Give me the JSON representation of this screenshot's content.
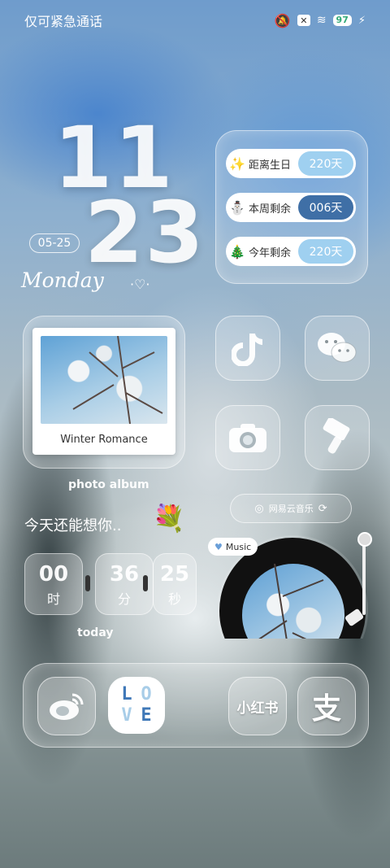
{
  "status_bar": {
    "carrier_text": "仅可紧急通话",
    "battery": "97"
  },
  "clock": {
    "hour": "11",
    "minute": "23",
    "date": "05-25",
    "weekday": "Monday"
  },
  "countdown": {
    "items": [
      {
        "emoji": "✨",
        "label": "距离生日",
        "value": "220天",
        "color": "#9fd0f0",
        "text_color": "#ffffff"
      },
      {
        "emoji": "⛄",
        "label": "本周剩余",
        "value": "006天",
        "color": "#3f6fa6",
        "text_color": "#ffffff"
      },
      {
        "emoji": "🎄",
        "label": "今年剩余",
        "value": "220天",
        "color": "#9fd0f0",
        "text_color": "#ffffff"
      }
    ]
  },
  "apps": {
    "douyin_icon": "tiktok-icon",
    "wechat_icon": "wechat-icon",
    "camera_icon": "camera-icon",
    "theme_icon": "brush-icon"
  },
  "photo_widget": {
    "caption": "Winter Romance",
    "label": "photo album"
  },
  "music_chip": {
    "label": "网易云音乐"
  },
  "slogan": "今天还能想你..",
  "timer": {
    "hours": "00",
    "hours_unit": "时",
    "minutes": "36",
    "minutes_unit": "分",
    "seconds": "25",
    "seconds_unit": "秒",
    "label": "today"
  },
  "music_widget": {
    "tag": "Music"
  },
  "dock": {
    "love_letters": [
      "L",
      "O",
      "V",
      "E"
    ],
    "xiaohongshu": "小红书",
    "alipay": "支"
  }
}
